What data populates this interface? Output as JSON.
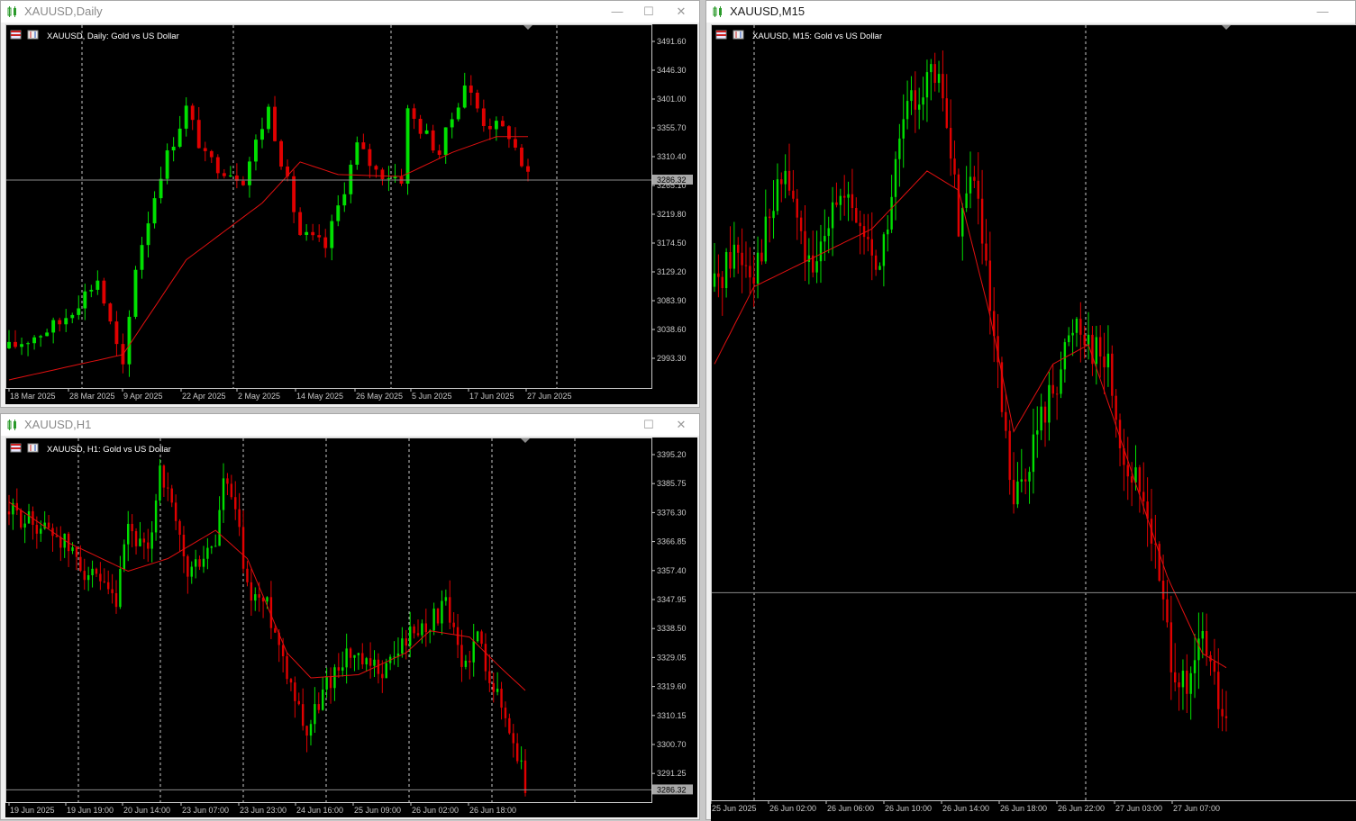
{
  "windows": {
    "daily": {
      "title": "XAUUSD,Daily",
      "header": "XAUUSD, Daily:  Gold vs US Dollar",
      "price_ticks": [
        "3491.60",
        "3446.30",
        "3401.00",
        "3355.70",
        "3310.40",
        "3265.10",
        "3219.80",
        "3174.50",
        "3129.20",
        "3083.90",
        "3038.60",
        "2993.30"
      ],
      "current_price": "3286.32",
      "time_ticks": [
        "18 Mar 2025",
        "28 Mar 2025",
        "9 Apr 2025",
        "22 Apr 2025",
        "2 May 2025",
        "14 May 2025",
        "26 May 2025",
        "5 Jun 2025",
        "17 Jun 2025",
        "27 Jun 2025"
      ]
    },
    "h1": {
      "title": "XAUUSD,H1",
      "header": "XAUUSD, H1:  Gold vs US Dollar",
      "price_ticks": [
        "3395.20",
        "3385.75",
        "3376.30",
        "3366.85",
        "3357.40",
        "3347.95",
        "3338.50",
        "3329.05",
        "3319.60",
        "3310.15",
        "3300.70",
        "3291.25"
      ],
      "current_price": "3286.32",
      "time_ticks": [
        "19 Jun 2025",
        "19 Jun 19:00",
        "20 Jun 14:00",
        "23 Jun 07:00",
        "23 Jun 23:00",
        "24 Jun 16:00",
        "25 Jun 09:00",
        "26 Jun 02:00",
        "26 Jun 18:00"
      ]
    },
    "m15": {
      "title": "XAUUSD,M15",
      "header": "XAUUSD, M15:  Gold vs US Dollar",
      "time_ticks": [
        "25 Jun 2025",
        "26 Jun 02:00",
        "26 Jun 06:00",
        "26 Jun 10:00",
        "26 Jun 14:00",
        "26 Jun 18:00",
        "26 Jun 22:00",
        "27 Jun 03:00",
        "27 Jun 07:00"
      ]
    }
  },
  "colors": {
    "bull": "#00e000",
    "bear": "#e00000",
    "ma": "#e01010",
    "grid": "#c8c8c8",
    "bg": "#000000"
  },
  "chart_data": [
    {
      "type": "candlestick",
      "title": "XAUUSD, Daily:  Gold vs US Dollar",
      "y_range": [
        2960,
        3530
      ],
      "anchors": [
        [
          0,
          3020
        ],
        [
          8,
          3060
        ],
        [
          14,
          3130
        ],
        [
          18,
          2985
        ],
        [
          20,
          3150
        ],
        [
          24,
          3300
        ],
        [
          28,
          3400
        ],
        [
          31,
          3320
        ],
        [
          37,
          3290
        ],
        [
          41,
          3400
        ],
        [
          46,
          3200
        ],
        [
          50,
          3180
        ],
        [
          55,
          3340
        ],
        [
          58,
          3300
        ],
        [
          62,
          3290
        ],
        [
          63,
          3395
        ],
        [
          68,
          3330
        ],
        [
          72,
          3440
        ],
        [
          75,
          3380
        ],
        [
          79,
          3360
        ],
        [
          82,
          3290
        ]
      ],
      "ma_anchors": [
        [
          0,
          2970
        ],
        [
          18,
          3010
        ],
        [
          28,
          3160
        ],
        [
          40,
          3250
        ],
        [
          46,
          3315
        ],
        [
          52,
          3295
        ],
        [
          62,
          3292
        ],
        [
          70,
          3330
        ],
        [
          77,
          3355
        ],
        [
          82,
          3355
        ]
      ],
      "last_price": 3286.32
    },
    {
      "type": "candlestick",
      "title": "XAUUSD, H1:  Gold vs US Dollar",
      "y_range": [
        3283,
        3398
      ],
      "anchors": [
        [
          0,
          3375
        ],
        [
          12,
          3368
        ],
        [
          20,
          3355
        ],
        [
          27,
          3345
        ],
        [
          30,
          3370
        ],
        [
          35,
          3360
        ],
        [
          38,
          3390
        ],
        [
          45,
          3355
        ],
        [
          52,
          3365
        ],
        [
          54,
          3385
        ],
        [
          57,
          3375
        ],
        [
          60,
          3350
        ],
        [
          65,
          3345
        ],
        [
          70,
          3325
        ],
        [
          75,
          3305
        ],
        [
          80,
          3320
        ],
        [
          85,
          3330
        ],
        [
          90,
          3325
        ],
        [
          95,
          3325
        ],
        [
          100,
          3335
        ],
        [
          106,
          3340
        ],
        [
          110,
          3345
        ],
        [
          114,
          3325
        ],
        [
          118,
          3335
        ],
        [
          122,
          3320
        ],
        [
          128,
          3298
        ],
        [
          130,
          3288
        ]
      ],
      "ma_anchors": [
        [
          0,
          3378
        ],
        [
          15,
          3365
        ],
        [
          30,
          3356
        ],
        [
          40,
          3360
        ],
        [
          52,
          3369
        ],
        [
          60,
          3360
        ],
        [
          70,
          3330
        ],
        [
          76,
          3322
        ],
        [
          88,
          3323
        ],
        [
          100,
          3330
        ],
        [
          106,
          3337
        ],
        [
          116,
          3335
        ],
        [
          124,
          3325
        ],
        [
          130,
          3318
        ]
      ],
      "last_price": 3286.32
    },
    {
      "type": "candlestick",
      "title": "XAUUSD, M15:  Gold vs US Dollar",
      "y_range": [
        3265,
        3345
      ],
      "anchors": [
        [
          0,
          3318
        ],
        [
          5,
          3322
        ],
        [
          10,
          3320
        ],
        [
          18,
          3330
        ],
        [
          25,
          3318
        ],
        [
          30,
          3328
        ],
        [
          36,
          3325
        ],
        [
          42,
          3320
        ],
        [
          48,
          3335
        ],
        [
          54,
          3340
        ],
        [
          58,
          3338
        ],
        [
          62,
          3325
        ],
        [
          66,
          3330
        ],
        [
          70,
          3315
        ],
        [
          76,
          3295
        ],
        [
          82,
          3303
        ],
        [
          88,
          3310
        ],
        [
          92,
          3315
        ],
        [
          96,
          3312
        ],
        [
          100,
          3310
        ],
        [
          104,
          3300
        ],
        [
          110,
          3295
        ],
        [
          116,
          3280
        ],
        [
          120,
          3275
        ],
        [
          124,
          3282
        ],
        [
          128,
          3275
        ],
        [
          130,
          3272
        ]
      ],
      "ma_anchors": [
        [
          0,
          3310
        ],
        [
          10,
          3318
        ],
        [
          20,
          3320
        ],
        [
          30,
          3322
        ],
        [
          40,
          3324
        ],
        [
          54,
          3330
        ],
        [
          62,
          3328
        ],
        [
          70,
          3315
        ],
        [
          76,
          3303
        ],
        [
          86,
          3310
        ],
        [
          95,
          3312
        ],
        [
          105,
          3300
        ],
        [
          115,
          3288
        ],
        [
          124,
          3280
        ]
      ],
      "last_price": 3286.32
    }
  ]
}
